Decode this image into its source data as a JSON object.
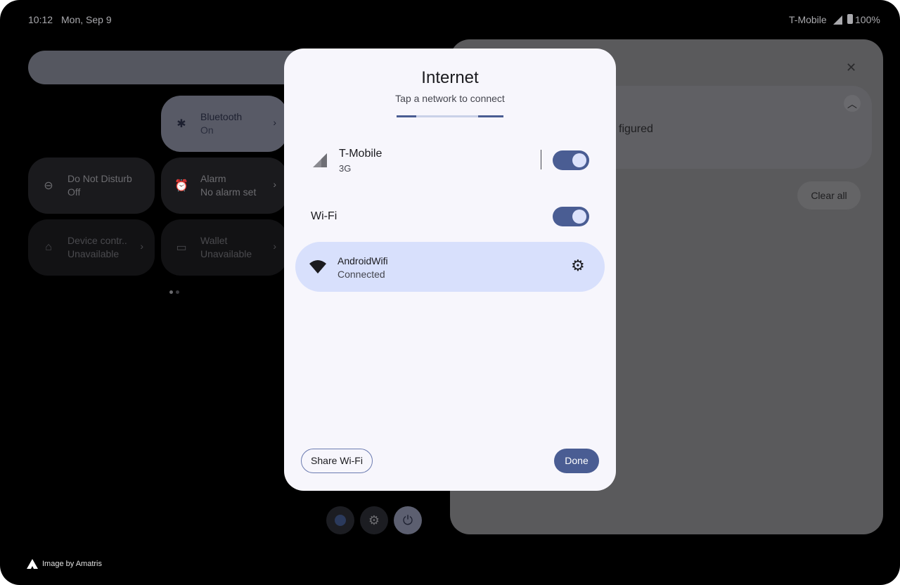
{
  "status_bar": {
    "time": "10:12",
    "date": "Mon, Sep 9",
    "carrier": "T-Mobile",
    "battery": "100%"
  },
  "quick_settings": {
    "tiles": [
      {
        "title": "Bluetooth",
        "subtitle": "On",
        "icon": "bluetooth-icon"
      },
      {
        "title": "Do Not Disturb",
        "subtitle": "Off",
        "icon": "dnd-icon"
      },
      {
        "title": "Alarm",
        "subtitle": "No alarm set",
        "icon": "alarm-icon"
      },
      {
        "title": "Device contr..",
        "subtitle": "Unavailable",
        "icon": "home-icon"
      },
      {
        "title": "Wallet",
        "subtitle": "Unavailable",
        "icon": "wallet-icon"
      }
    ]
  },
  "notifications": {
    "partial_text": "figured",
    "clear_all": "Clear all"
  },
  "dialog": {
    "title": "Internet",
    "subtitle": "Tap a network to connect",
    "mobile": {
      "name": "T-Mobile",
      "type": "3G",
      "enabled": true
    },
    "wifi": {
      "label": "Wi-Fi",
      "enabled": true
    },
    "connected_network": {
      "name": "AndroidWifi",
      "status": "Connected"
    },
    "share_button": "Share Wi-Fi",
    "done_button": "Done"
  },
  "colors": {
    "accent": "#4a5d93",
    "connected_bg": "#d8e0fc",
    "dialog_bg": "#f7f6fc"
  },
  "watermark": "Image by Amatris"
}
